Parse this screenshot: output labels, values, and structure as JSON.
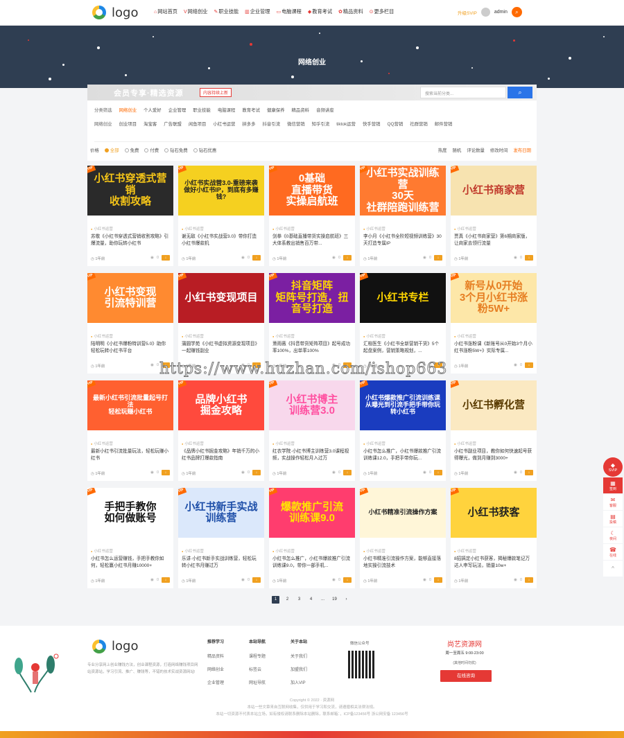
{
  "header": {
    "logo_text": "logo",
    "nav": [
      {
        "icon": "home-icon",
        "glyph": "⌂",
        "label": "网站首页"
      },
      {
        "icon": "v-icon",
        "glyph": "V",
        "label": "网络创业"
      },
      {
        "icon": "skill-icon",
        "glyph": "✎",
        "label": "职业技能"
      },
      {
        "icon": "chart-icon",
        "glyph": "▥",
        "label": "企业管理"
      },
      {
        "icon": "monitor-icon",
        "glyph": "▭",
        "label": "电脑课程"
      },
      {
        "icon": "edu-icon",
        "glyph": "◆",
        "label": "教育考试"
      },
      {
        "icon": "gift-icon",
        "glyph": "✿",
        "label": "精品资料"
      },
      {
        "icon": "more-icon",
        "glyph": "⊙",
        "label": "更多栏目"
      }
    ],
    "vip_upgrade": "升级SVIP",
    "username": "admin"
  },
  "banner": {
    "title": "网络创业"
  },
  "filter": {
    "tagline": "会员专享·精选资源",
    "new_badge": "内容持续上新",
    "search_placeholder": "搜索当前分类...",
    "row1_label": "分类筛选",
    "row1": [
      "网络创业",
      "个人爱好",
      "企业管理",
      "职业技能",
      "电脑课程",
      "教育考试",
      "健康保养",
      "精品资料",
      "音频讲座"
    ],
    "row2_label": "网络创业",
    "row2": [
      "创业项目",
      "淘宝客",
      "广告联盟",
      "闲鱼项目",
      "小红书运营",
      "拼多多",
      "抖音引流",
      "微信营销",
      "知乎引流",
      "tiktok运营",
      "快手营销",
      "QQ营销",
      "社群营销",
      "邮件营销"
    ],
    "price_label": "价格",
    "price_options": [
      "全部",
      "免费",
      "付费",
      "钻石免费",
      "钻石优惠"
    ],
    "sort_options": [
      "热度",
      "随机",
      "评论数量",
      "修改时间",
      "发布日期"
    ]
  },
  "cards": [
    {
      "thumb": "小红书穿透式营销\n收割攻略",
      "bg": "#2a2a2a",
      "fg": "#f5c518",
      "cat": "小红书运营",
      "title": "苏敬《小红书穿透式营销收割攻略》引爆流量，助你玩转小红书",
      "time": "1年前",
      "views": "0",
      "vip": true
    },
    {
      "thumb": "小红书实战营3.0-重磅来袭\n做好小红书IP，到底有多赚钱?",
      "bg": "#f5d020",
      "fg": "#222",
      "cat": "小红书运营",
      "title": "谢无敌《小红书实战营3.0》带你打造小红书爆款机",
      "time": "1年前",
      "views": "0",
      "vip": true
    },
    {
      "thumb": "0基础\n直播带货\n实操启航班",
      "bg": "#ff6a20",
      "fg": "#fff",
      "cat": "小红书运营",
      "title": "剑拳《0基础直播带货实操启航班》三大体系教出销售百万带...",
      "time": "1年前",
      "views": "0",
      "vip": true
    },
    {
      "thumb": "小红书实战训练营\n30天\n社群陪跑训练营",
      "bg": "#ff7a30",
      "fg": "#fff",
      "cat": "小红书运营",
      "title": "李小月《小红书全阶短视频训练营》30天打造专属IP",
      "time": "1年前",
      "views": "0",
      "vip": true
    },
    {
      "thumb": "小红书商家营",
      "bg": "#f7e3b0",
      "fg": "#c0392b",
      "cat": "小红书运营",
      "title": "贾真《小红书商家营》第6期商家版，让商家去领行流量",
      "time": "1年前",
      "views": "0",
      "vip": true
    },
    {
      "thumb": "小红书变现\n引流特训营",
      "bg": "#ff8a30",
      "fg": "#fff",
      "cat": "小红书运营",
      "title": "陆明明《小红书爆粉特训营5.0》助你轻松玩转小红书平台",
      "time": "1年前",
      "views": "0",
      "vip": true
    },
    {
      "thumb": "小红书变现项目",
      "bg": "#b81d24",
      "fg": "#fff",
      "cat": "小红书运营",
      "title": "蒲圆学苑《小红书虚拟资源变现项目》一起赚钱副业",
      "time": "1年前",
      "views": "0",
      "vip": true
    },
    {
      "thumb": "抖音矩阵\n矩阵号打造，扭音号打造",
      "bg": "#7b1fa2",
      "fg": "#ffd600",
      "cat": "小红书运营",
      "title": "萧雨薇《抖音带货矩阵项目》起号成功率100%，出单率100%",
      "time": "1年前",
      "views": "0",
      "vip": true
    },
    {
      "thumb": "小红书专栏",
      "bg": "#111",
      "fg": "#ffd600",
      "cat": "小红书运营",
      "title": "汇楦医生《小红书全新营销干货》5个起盘案例，营销策略规划，...",
      "time": "1年前",
      "views": "0",
      "vip": true
    },
    {
      "thumb": "新号从0开始\n3个月小红书涨粉5W+",
      "bg": "#fde7a8",
      "fg": "#e67e22",
      "cat": "小红书运营",
      "title": "小红书涨粉课《新账号从0开始3个月小红书涨粉5W+》实际专属...",
      "time": "1年前",
      "views": "0",
      "vip": true
    },
    {
      "thumb": "最新小红书引流批量起号打法\n轻松玩赚小红书",
      "bg": "#ff6030",
      "fg": "#fff",
      "cat": "小红书运营",
      "title": "最新小红书引流批量玩法，轻松玩赚小红书",
      "time": "1年前",
      "views": "0",
      "vip": true
    },
    {
      "thumb": "品牌小红书\n掘金攻略",
      "bg": "#ff4a3d",
      "fg": "#fff",
      "cat": "小红书运营",
      "title": "《品牌小红书掘金攻略》年销千万的小红书品牌打爆款指南",
      "time": "1年前",
      "views": "0",
      "vip": true
    },
    {
      "thumb": "小红书博主\n训练营3.0",
      "bg": "#f8d8ec",
      "fg": "#ff4fa0",
      "cat": "小红书运营",
      "title": "红衣学院·小红书博主训练营3.0课程视频，实战操作轻松月入过万",
      "time": "1年前",
      "views": "0",
      "vip": true
    },
    {
      "thumb": "小红书爆款推广引流训练课\n从曝光到引流手把手带你玩转小红书",
      "bg": "#1a3cbf",
      "fg": "#fff",
      "cat": "小红书运营",
      "title": "小红书怎么推广，小红书爆款推广引流训练课12.0，手把手带你玩...",
      "time": "1年前",
      "views": "0",
      "vip": true
    },
    {
      "thumb": "小红书孵化营",
      "bg": "#fbe9c2",
      "fg": "#5a3b00",
      "cat": "小红书运营",
      "title": "小红书副业项目，教你如何快速起号获得曝光，做到月赚到3000+",
      "time": "1年前",
      "views": "0",
      "vip": true
    },
    {
      "thumb": "手把手教你\n如何做账号",
      "bg": "#fff",
      "fg": "#111",
      "cat": "小红书运营",
      "title": "小红书怎么运营赚钱，手把手教你如何，轻松赢小红书月赚10000+",
      "time": "1年前",
      "views": "0",
      "vip": true
    },
    {
      "thumb": "小红书新手实战训练营",
      "bg": "#dbe8fb",
      "fg": "#1d4ea8",
      "cat": "小红书运营",
      "title": "乐讲·小红书新手实战训练营，轻松玩转小红书月赚过万",
      "time": "1年前",
      "views": "0",
      "vip": true
    },
    {
      "thumb": "爆款推广引流\n训练课9.0",
      "bg": "#ff3d6e",
      "fg": "#ffe600",
      "cat": "小红书运营",
      "title": "小红书怎么推广，小红书爆款推广引流训练课9.0，带你一部手机...",
      "time": "1年前",
      "views": "0",
      "vip": true
    },
    {
      "thumb": "小红书精准引流操作方案",
      "bg": "#fff6d8",
      "fg": "#222",
      "cat": "小红书运营",
      "title": "小红书精准引流操作方案，能够直接落地实操引流技术",
      "time": "1年前",
      "views": "0",
      "vip": true
    },
    {
      "thumb": "小红书获客",
      "bg": "#ffd33d",
      "fg": "#222",
      "cat": "小红书运营",
      "title": "8招搞定小红书获客，揭秘爆款笔记万达人申写玩法，销量10w+",
      "time": "1年前",
      "views": "0",
      "vip": true
    }
  ],
  "pager": [
    "1",
    "2",
    "3",
    "4",
    "...",
    "19",
    "›"
  ],
  "watermark": "https://www.huzhan.com/ishop663",
  "side_tools": [
    {
      "icon": "diamond-icon",
      "label": "SVIP"
    },
    {
      "icon": "gift-icon",
      "label": "签到"
    },
    {
      "icon": "bell-icon",
      "label": "客服"
    },
    {
      "icon": "doc-icon",
      "label": "投稿"
    },
    {
      "icon": "moon-icon",
      "label": "夜间"
    },
    {
      "icon": "chat-icon",
      "label": "在线"
    },
    {
      "icon": "up-icon",
      "label": "^"
    }
  ],
  "footer": {
    "logo_text": "logo",
    "desc": "专业分享网上创业赚钱方法，创业课程资源，打造网络赚钱项目网站资源站，学习引流、推广、赚钱等，不错的技术实战资源网站!",
    "cols": [
      {
        "title": "推荐学习",
        "links": [
          "精品资料",
          "网络创业",
          "企业管理"
        ]
      },
      {
        "title": "本站导航",
        "links": [
          "课程专题",
          "标签云",
          "网址导航"
        ]
      },
      {
        "title": "关于本站",
        "links": [
          "关于我们",
          "加盟我们",
          "加入VIP"
        ]
      }
    ],
    "qr_title": "微信公众号",
    "shop_title": "尚艺资源网",
    "shop_time": "周一至周五 9:00-23:00",
    "shop_note": "(其他时间勿扰)",
    "shop_btn": "在线咨询",
    "copyright": "Copyright © 2022 · 资源网",
    "notice1": "本站一些文章来自互联网收集，仅供用于学习和交流，请遵循相关法律法规。",
    "notice2": "本站一切资源不代表本站立场，如有侵权请联系删除本站删除，联系邮箱：，ICP备123456号 浙公网安备 123456号"
  }
}
